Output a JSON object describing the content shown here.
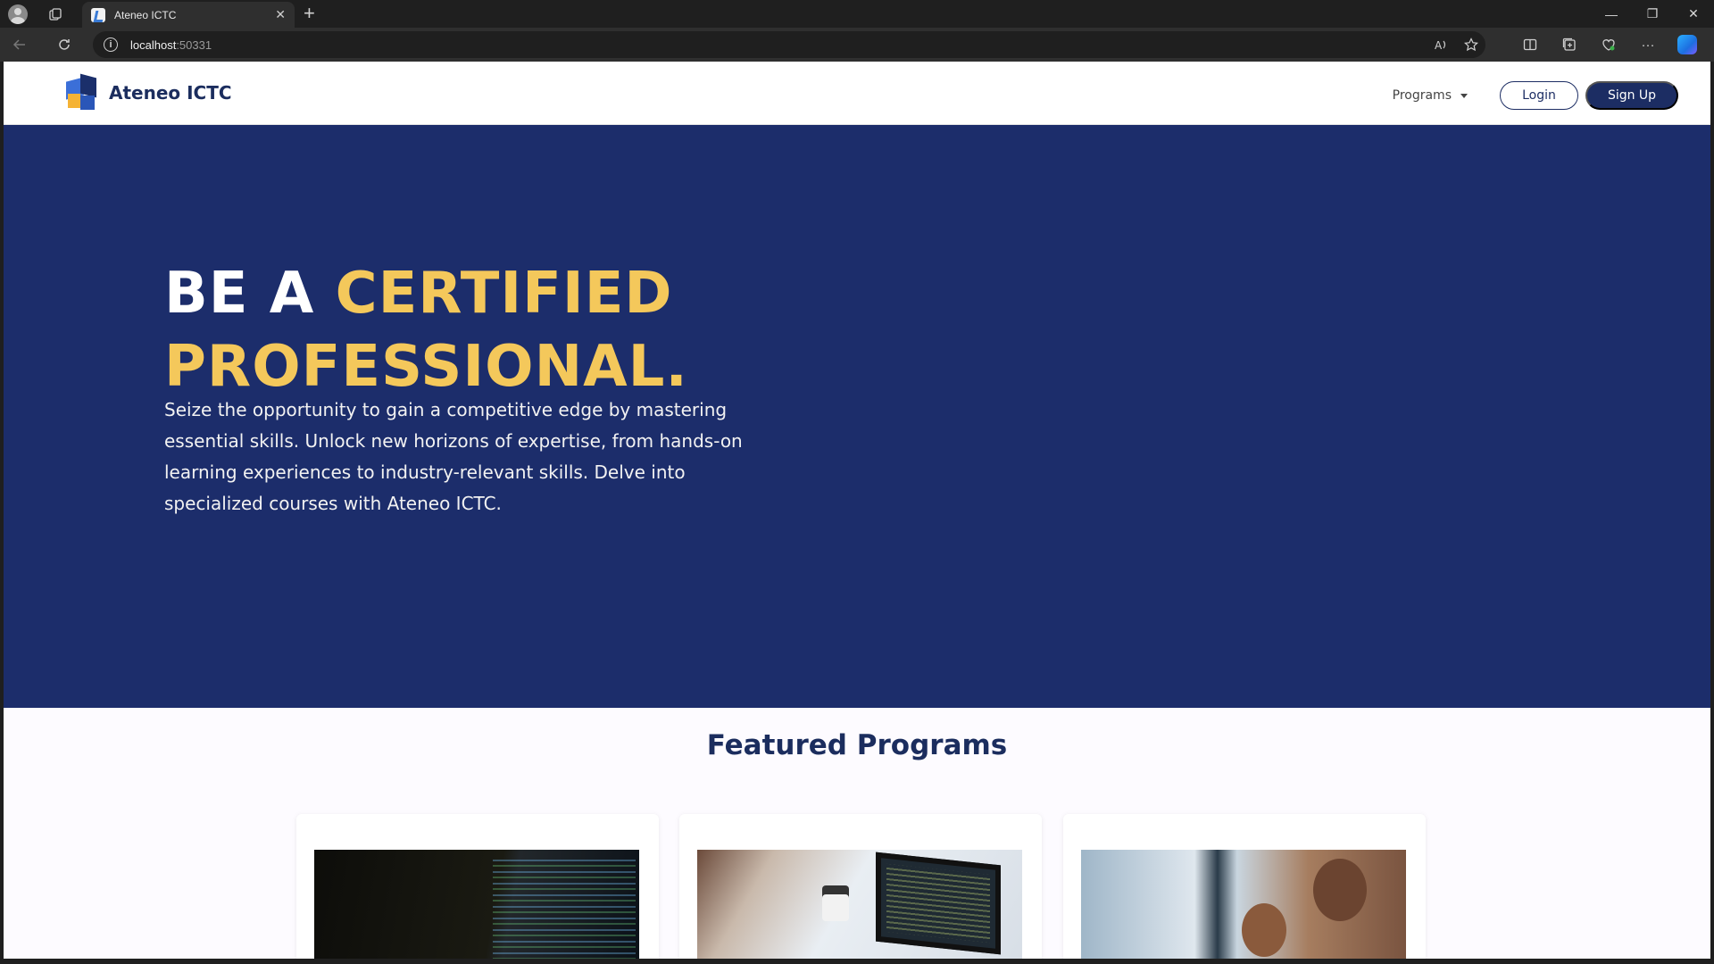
{
  "browser": {
    "tab_title": "Ateneo ICTC",
    "new_tab": "+",
    "tab_close": "✕",
    "url_host": "localhost",
    "url_port": ":50331",
    "window_controls": {
      "minimize": "—",
      "restore": "❐",
      "close": "✕"
    }
  },
  "site": {
    "brand": "Ateneo ICTC",
    "nav": {
      "programs": "Programs",
      "login": "Login",
      "signup": "Sign Up"
    }
  },
  "hero": {
    "title_white": "BE A ",
    "title_yellow_1": "CERTIFIED",
    "title_yellow_2": "PROFESSIONAL.",
    "description": "Seize the opportunity to gain a competitive edge by mastering essential skills. Unlock new horizons of expertise, from hands-on learning experiences to industry-relevant skills. Delve into specialized courses with Ateneo ICTC."
  },
  "featured": {
    "title": "Featured Programs",
    "cards": [
      {
        "image": "code-on-monitor"
      },
      {
        "image": "laptop-and-coffee"
      },
      {
        "image": "team-at-screen"
      }
    ]
  },
  "colors": {
    "hero_bg": "#1c2d6b",
    "accent_yellow": "#f4c85b",
    "brand_navy": "#1c2d63"
  }
}
